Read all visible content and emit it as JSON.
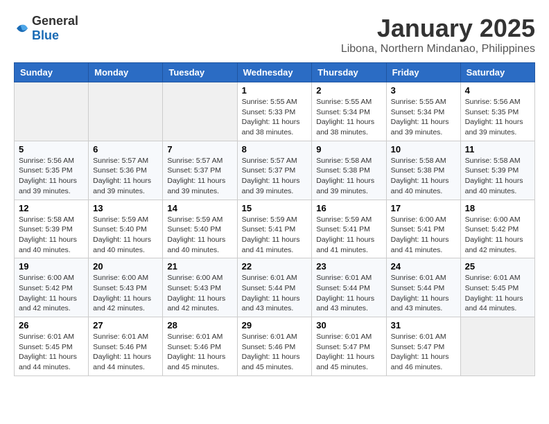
{
  "logo": {
    "text_general": "General",
    "text_blue": "Blue"
  },
  "header": {
    "month": "January 2025",
    "location": "Libona, Northern Mindanao, Philippines"
  },
  "weekdays": [
    "Sunday",
    "Monday",
    "Tuesday",
    "Wednesday",
    "Thursday",
    "Friday",
    "Saturday"
  ],
  "weeks": [
    [
      {
        "day": "",
        "sunrise": "",
        "sunset": "",
        "daylight": ""
      },
      {
        "day": "",
        "sunrise": "",
        "sunset": "",
        "daylight": ""
      },
      {
        "day": "",
        "sunrise": "",
        "sunset": "",
        "daylight": ""
      },
      {
        "day": "1",
        "sunrise": "Sunrise: 5:55 AM",
        "sunset": "Sunset: 5:33 PM",
        "daylight": "Daylight: 11 hours and 38 minutes."
      },
      {
        "day": "2",
        "sunrise": "Sunrise: 5:55 AM",
        "sunset": "Sunset: 5:34 PM",
        "daylight": "Daylight: 11 hours and 38 minutes."
      },
      {
        "day": "3",
        "sunrise": "Sunrise: 5:55 AM",
        "sunset": "Sunset: 5:34 PM",
        "daylight": "Daylight: 11 hours and 39 minutes."
      },
      {
        "day": "4",
        "sunrise": "Sunrise: 5:56 AM",
        "sunset": "Sunset: 5:35 PM",
        "daylight": "Daylight: 11 hours and 39 minutes."
      }
    ],
    [
      {
        "day": "5",
        "sunrise": "Sunrise: 5:56 AM",
        "sunset": "Sunset: 5:35 PM",
        "daylight": "Daylight: 11 hours and 39 minutes."
      },
      {
        "day": "6",
        "sunrise": "Sunrise: 5:57 AM",
        "sunset": "Sunset: 5:36 PM",
        "daylight": "Daylight: 11 hours and 39 minutes."
      },
      {
        "day": "7",
        "sunrise": "Sunrise: 5:57 AM",
        "sunset": "Sunset: 5:37 PM",
        "daylight": "Daylight: 11 hours and 39 minutes."
      },
      {
        "day": "8",
        "sunrise": "Sunrise: 5:57 AM",
        "sunset": "Sunset: 5:37 PM",
        "daylight": "Daylight: 11 hours and 39 minutes."
      },
      {
        "day": "9",
        "sunrise": "Sunrise: 5:58 AM",
        "sunset": "Sunset: 5:38 PM",
        "daylight": "Daylight: 11 hours and 39 minutes."
      },
      {
        "day": "10",
        "sunrise": "Sunrise: 5:58 AM",
        "sunset": "Sunset: 5:38 PM",
        "daylight": "Daylight: 11 hours and 40 minutes."
      },
      {
        "day": "11",
        "sunrise": "Sunrise: 5:58 AM",
        "sunset": "Sunset: 5:39 PM",
        "daylight": "Daylight: 11 hours and 40 minutes."
      }
    ],
    [
      {
        "day": "12",
        "sunrise": "Sunrise: 5:58 AM",
        "sunset": "Sunset: 5:39 PM",
        "daylight": "Daylight: 11 hours and 40 minutes."
      },
      {
        "day": "13",
        "sunrise": "Sunrise: 5:59 AM",
        "sunset": "Sunset: 5:40 PM",
        "daylight": "Daylight: 11 hours and 40 minutes."
      },
      {
        "day": "14",
        "sunrise": "Sunrise: 5:59 AM",
        "sunset": "Sunset: 5:40 PM",
        "daylight": "Daylight: 11 hours and 40 minutes."
      },
      {
        "day": "15",
        "sunrise": "Sunrise: 5:59 AM",
        "sunset": "Sunset: 5:41 PM",
        "daylight": "Daylight: 11 hours and 41 minutes."
      },
      {
        "day": "16",
        "sunrise": "Sunrise: 5:59 AM",
        "sunset": "Sunset: 5:41 PM",
        "daylight": "Daylight: 11 hours and 41 minutes."
      },
      {
        "day": "17",
        "sunrise": "Sunrise: 6:00 AM",
        "sunset": "Sunset: 5:41 PM",
        "daylight": "Daylight: 11 hours and 41 minutes."
      },
      {
        "day": "18",
        "sunrise": "Sunrise: 6:00 AM",
        "sunset": "Sunset: 5:42 PM",
        "daylight": "Daylight: 11 hours and 42 minutes."
      }
    ],
    [
      {
        "day": "19",
        "sunrise": "Sunrise: 6:00 AM",
        "sunset": "Sunset: 5:42 PM",
        "daylight": "Daylight: 11 hours and 42 minutes."
      },
      {
        "day": "20",
        "sunrise": "Sunrise: 6:00 AM",
        "sunset": "Sunset: 5:43 PM",
        "daylight": "Daylight: 11 hours and 42 minutes."
      },
      {
        "day": "21",
        "sunrise": "Sunrise: 6:00 AM",
        "sunset": "Sunset: 5:43 PM",
        "daylight": "Daylight: 11 hours and 42 minutes."
      },
      {
        "day": "22",
        "sunrise": "Sunrise: 6:01 AM",
        "sunset": "Sunset: 5:44 PM",
        "daylight": "Daylight: 11 hours and 43 minutes."
      },
      {
        "day": "23",
        "sunrise": "Sunrise: 6:01 AM",
        "sunset": "Sunset: 5:44 PM",
        "daylight": "Daylight: 11 hours and 43 minutes."
      },
      {
        "day": "24",
        "sunrise": "Sunrise: 6:01 AM",
        "sunset": "Sunset: 5:44 PM",
        "daylight": "Daylight: 11 hours and 43 minutes."
      },
      {
        "day": "25",
        "sunrise": "Sunrise: 6:01 AM",
        "sunset": "Sunset: 5:45 PM",
        "daylight": "Daylight: 11 hours and 44 minutes."
      }
    ],
    [
      {
        "day": "26",
        "sunrise": "Sunrise: 6:01 AM",
        "sunset": "Sunset: 5:45 PM",
        "daylight": "Daylight: 11 hours and 44 minutes."
      },
      {
        "day": "27",
        "sunrise": "Sunrise: 6:01 AM",
        "sunset": "Sunset: 5:46 PM",
        "daylight": "Daylight: 11 hours and 44 minutes."
      },
      {
        "day": "28",
        "sunrise": "Sunrise: 6:01 AM",
        "sunset": "Sunset: 5:46 PM",
        "daylight": "Daylight: 11 hours and 45 minutes."
      },
      {
        "day": "29",
        "sunrise": "Sunrise: 6:01 AM",
        "sunset": "Sunset: 5:46 PM",
        "daylight": "Daylight: 11 hours and 45 minutes."
      },
      {
        "day": "30",
        "sunrise": "Sunrise: 6:01 AM",
        "sunset": "Sunset: 5:47 PM",
        "daylight": "Daylight: 11 hours and 45 minutes."
      },
      {
        "day": "31",
        "sunrise": "Sunrise: 6:01 AM",
        "sunset": "Sunset: 5:47 PM",
        "daylight": "Daylight: 11 hours and 46 minutes."
      },
      {
        "day": "",
        "sunrise": "",
        "sunset": "",
        "daylight": ""
      }
    ]
  ]
}
